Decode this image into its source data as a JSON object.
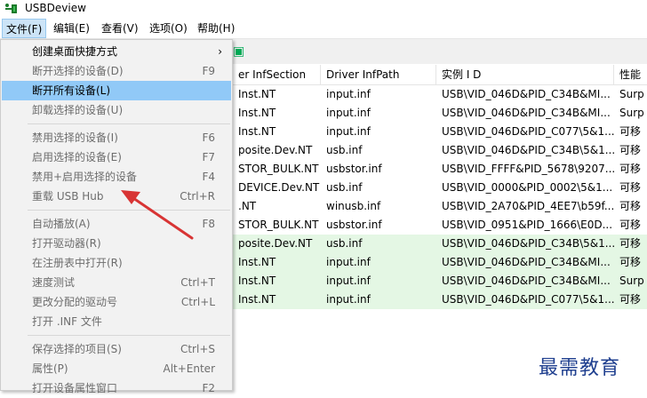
{
  "window": {
    "title": "USBDeview",
    "icon": "usb-plug-icon"
  },
  "menubar": [
    {
      "label": "文件(F)"
    },
    {
      "label": "编辑(E)"
    },
    {
      "label": "查看(V)"
    },
    {
      "label": "选项(O)"
    },
    {
      "label": "帮助(H)"
    }
  ],
  "table": {
    "headers": [
      "er InfSection",
      "Driver InfPath",
      "实例 I D",
      "性能"
    ],
    "rows": [
      {
        "c1": "Inst.NT",
        "c2": "input.inf",
        "c3": "USB\\VID_046D&PID_C34B&MI...",
        "c4": "Surp",
        "status": "normal"
      },
      {
        "c1": "Inst.NT",
        "c2": "input.inf",
        "c3": "USB\\VID_046D&PID_C34B&MI...",
        "c4": "Surp",
        "status": "normal"
      },
      {
        "c1": "Inst.NT",
        "c2": "input.inf",
        "c3": "USB\\VID_046D&PID_C077\\5&1...",
        "c4": "可移",
        "status": "normal"
      },
      {
        "c1": "posite.Dev.NT",
        "c2": "usb.inf",
        "c3": "USB\\VID_046D&PID_C34B\\5&1...",
        "c4": "可移",
        "status": "normal"
      },
      {
        "c1": "STOR_BULK.NT",
        "c2": "usbstor.inf",
        "c3": "USB\\VID_FFFF&PID_5678\\9207...",
        "c4": "可移",
        "status": "normal"
      },
      {
        "c1": "DEVICE.Dev.NT",
        "c2": "usb.inf",
        "c3": "USB\\VID_0000&PID_0002\\5&1...",
        "c4": "可移",
        "status": "normal"
      },
      {
        "c1": ".NT",
        "c2": "winusb.inf",
        "c3": "USB\\VID_2A70&PID_4EE7\\b59f...",
        "c4": "可移",
        "status": "normal"
      },
      {
        "c1": "STOR_BULK.NT",
        "c2": "usbstor.inf",
        "c3": "USB\\VID_0951&PID_1666\\E0D...",
        "c4": "可移",
        "status": "normal"
      },
      {
        "c1": "posite.Dev.NT",
        "c2": "usb.inf",
        "c3": "USB\\VID_046D&PID_C34B\\5&1...",
        "c4": "可移",
        "status": "connected"
      },
      {
        "c1": "Inst.NT",
        "c2": "input.inf",
        "c3": "USB\\VID_046D&PID_C34B&MI...",
        "c4": "可移",
        "status": "connected"
      },
      {
        "c1": "Inst.NT",
        "c2": "input.inf",
        "c3": "USB\\VID_046D&PID_C34B&MI...",
        "c4": "Surp",
        "status": "connected"
      },
      {
        "c1": "Inst.NT",
        "c2": "input.inf",
        "c3": "USB\\VID_046D&PID_C077\\5&1...",
        "c4": "可移",
        "status": "connected"
      }
    ]
  },
  "file_menu": {
    "items": [
      {
        "label": "创建桌面快捷方式",
        "shortcut": "",
        "submenu": true,
        "state": "enabled"
      },
      {
        "label": "断开选择的设备(D)",
        "shortcut": "F9",
        "state": "disabled"
      },
      {
        "label": "断开所有设备(L)",
        "shortcut": "",
        "state": "highlighted"
      },
      {
        "label": "卸载选择的设备(U)",
        "shortcut": "",
        "state": "disabled"
      },
      {
        "separator": true
      },
      {
        "label": "禁用选择的设备(I)",
        "shortcut": "F6",
        "state": "disabled"
      },
      {
        "label": "启用选择的设备(E)",
        "shortcut": "F7",
        "state": "disabled"
      },
      {
        "label": "禁用+启用选择的设备",
        "shortcut": "F4",
        "state": "disabled"
      },
      {
        "label": "重载 USB Hub",
        "shortcut": "Ctrl+R",
        "state": "disabled"
      },
      {
        "separator": true
      },
      {
        "label": "自动播放(A)",
        "shortcut": "F8",
        "state": "disabled"
      },
      {
        "label": "打开驱动器(R)",
        "shortcut": "",
        "state": "disabled"
      },
      {
        "label": "在注册表中打开(R)",
        "shortcut": "",
        "state": "disabled"
      },
      {
        "label": "速度测试",
        "shortcut": "Ctrl+T",
        "state": "disabled"
      },
      {
        "label": "更改分配的驱动号",
        "shortcut": "Ctrl+L",
        "state": "disabled"
      },
      {
        "label": "打开 .INF 文件",
        "shortcut": "",
        "state": "disabled"
      },
      {
        "separator": true
      },
      {
        "label": "保存选择的项目(S)",
        "shortcut": "Ctrl+S",
        "state": "disabled"
      },
      {
        "label": "属性(P)",
        "shortcut": "Alt+Enter",
        "state": "disabled"
      },
      {
        "label": "打开设备属性窗口",
        "shortcut": "F2",
        "state": "disabled"
      }
    ]
  },
  "watermark": {
    "text": "最需教育"
  },
  "colors": {
    "highlight": "#91c9f7",
    "connected_row": "#e4f7e4",
    "arrow": "#d83434",
    "watermark": "#1f3f8f"
  }
}
